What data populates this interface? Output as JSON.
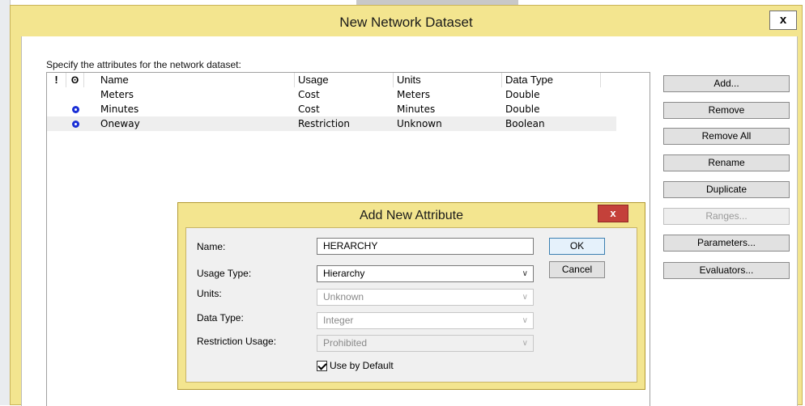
{
  "main_dialog": {
    "title": "New Network Dataset",
    "close_glyph": "x",
    "instructions": "Specify the attributes for the network dataset:",
    "columns": {
      "excl": "!",
      "default": "ʘ",
      "name": "Name",
      "usage": "Usage",
      "units": "Units",
      "data_type": "Data Type"
    },
    "rows": [
      {
        "name": "Meters",
        "usage": "Cost",
        "units": "Meters",
        "data_type": "Double",
        "default": false
      },
      {
        "name": "Minutes",
        "usage": "Cost",
        "units": "Minutes",
        "data_type": "Double",
        "default": true
      },
      {
        "name": "Oneway",
        "usage": "Restriction",
        "units": "Unknown",
        "data_type": "Boolean",
        "default": true
      }
    ],
    "buttons": {
      "add": "Add...",
      "remove": "Remove",
      "remove_all": "Remove All",
      "rename": "Rename",
      "duplicate": "Duplicate",
      "ranges": "Ranges...",
      "parameters": "Parameters...",
      "evaluators": "Evaluators..."
    }
  },
  "add_attribute_dialog": {
    "title": "Add New Attribute",
    "close_glyph": "x",
    "labels": {
      "name": "Name:",
      "usage_type": "Usage Type:",
      "units": "Units:",
      "data_type": "Data Type:",
      "restriction_usage": "Restriction Usage:"
    },
    "values": {
      "name": "HERARCHY",
      "usage_type": "Hierarchy",
      "units": "Unknown",
      "data_type": "Integer",
      "restriction_usage": "Prohibited"
    },
    "checkbox_label": "Use by Default",
    "checkbox_checked": true,
    "ok": "OK",
    "cancel": "Cancel"
  },
  "icons": {
    "default_dot": "default-attribute-icon",
    "chevron": "∨"
  },
  "colors": {
    "title_bar": "#f3e58f",
    "close_red": "#c4413a",
    "default_dot": "#1a2fd6"
  }
}
